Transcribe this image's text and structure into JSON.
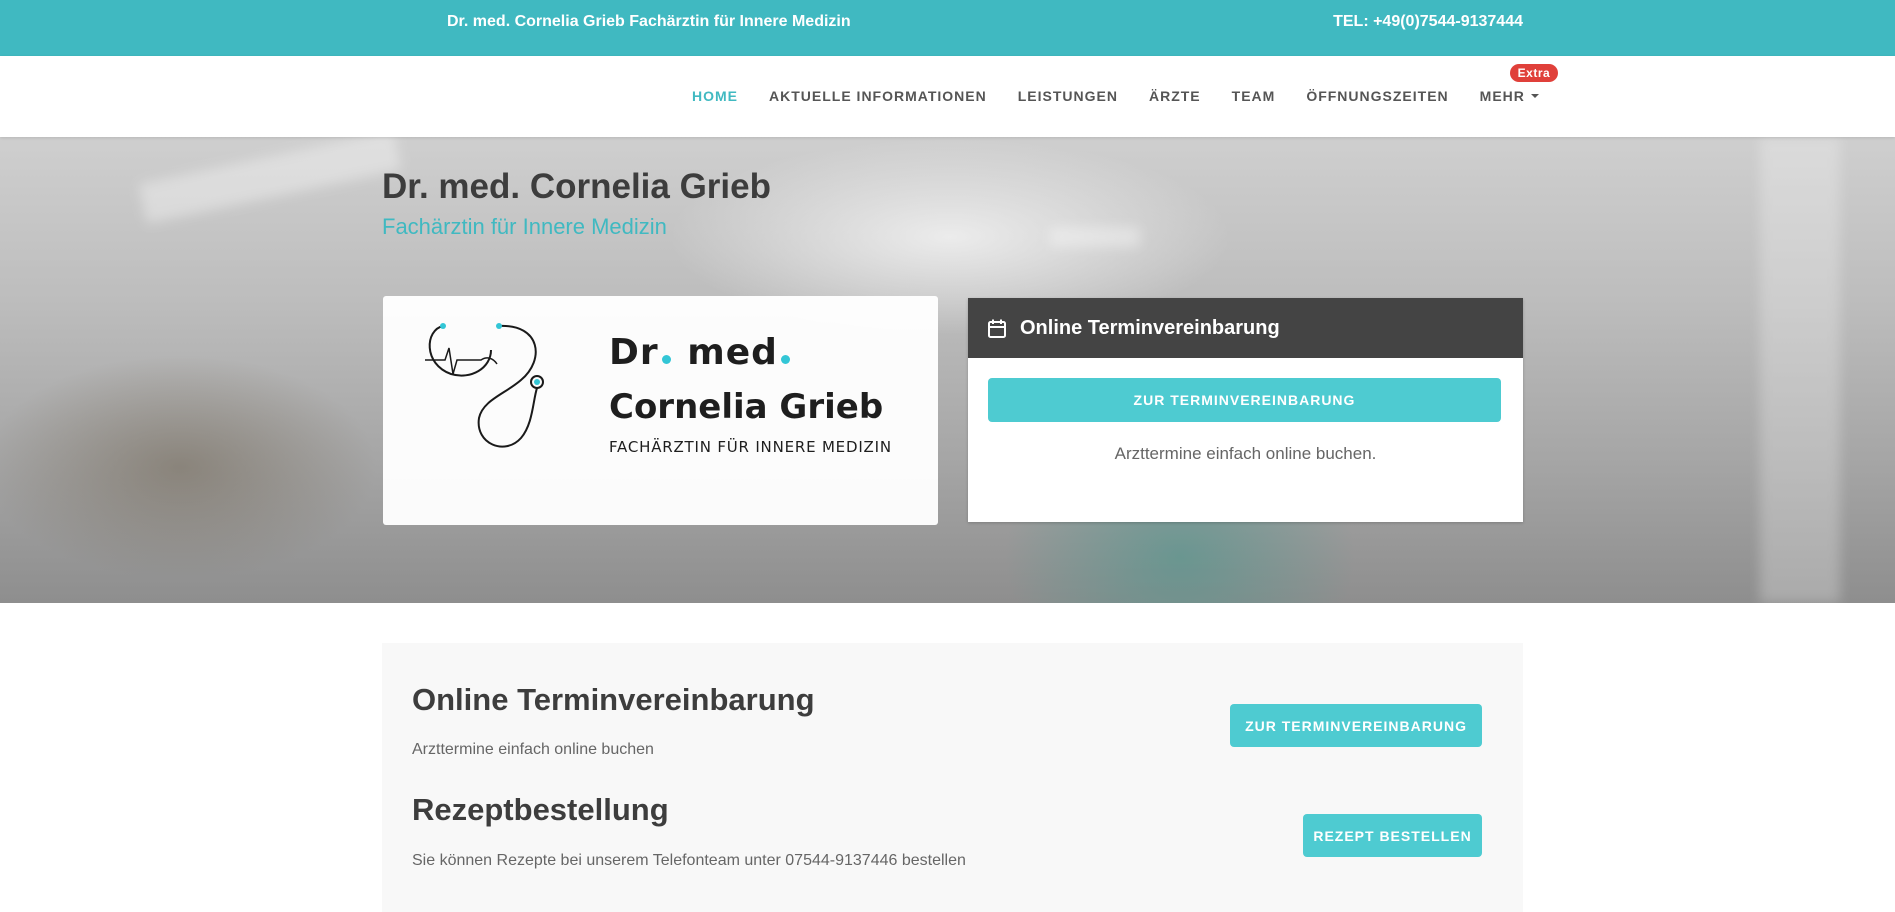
{
  "topbar": {
    "title": "Dr. med. Cornelia Grieb Fachärztin für Innere Medizin",
    "tel": "TEL: +49(0)7544-9137444"
  },
  "nav": {
    "items": [
      "HOME",
      "AKTUELLE INFORMATIONEN",
      "LEISTUNGEN",
      "ÄRZTE",
      "TEAM",
      "ÖFFNUNGSZEITEN",
      "MEHR"
    ],
    "active": "HOME",
    "more_badge": "Extra"
  },
  "hero": {
    "title": "Dr. med. Cornelia Grieb",
    "subtitle": "Fachärztin für Innere Medizin",
    "logo": {
      "line1_a": "Dr",
      "line1_b": "med",
      "line2": "Cornelia Grieb",
      "line3": "FACHÄRZTIN FÜR INNERE MEDIZIN"
    },
    "appointment_card": {
      "heading": "Online Terminvereinbarung",
      "button": "ZUR TERMINVEREINBARUNG",
      "text": "Arzttermine einfach online buchen."
    }
  },
  "sections": [
    {
      "heading": "Online Terminvereinbarung",
      "text": "Arzttermine einfach online buchen",
      "button": "ZUR TERMINVEREINBARUNG"
    },
    {
      "heading": "Rezeptbestellung",
      "text": "Sie können Rezepte bei unserem Telefonteam unter 07544-9137446 bestellen",
      "button": "REZEPT BESTELLEN"
    }
  ],
  "colors": {
    "accent": "#40b9c1",
    "button": "#4ecbd1",
    "badge": "#e0403a",
    "card_header": "#444444"
  },
  "icons": [
    "calendar-icon",
    "caret-down-icon",
    "stethoscope-icon"
  ]
}
